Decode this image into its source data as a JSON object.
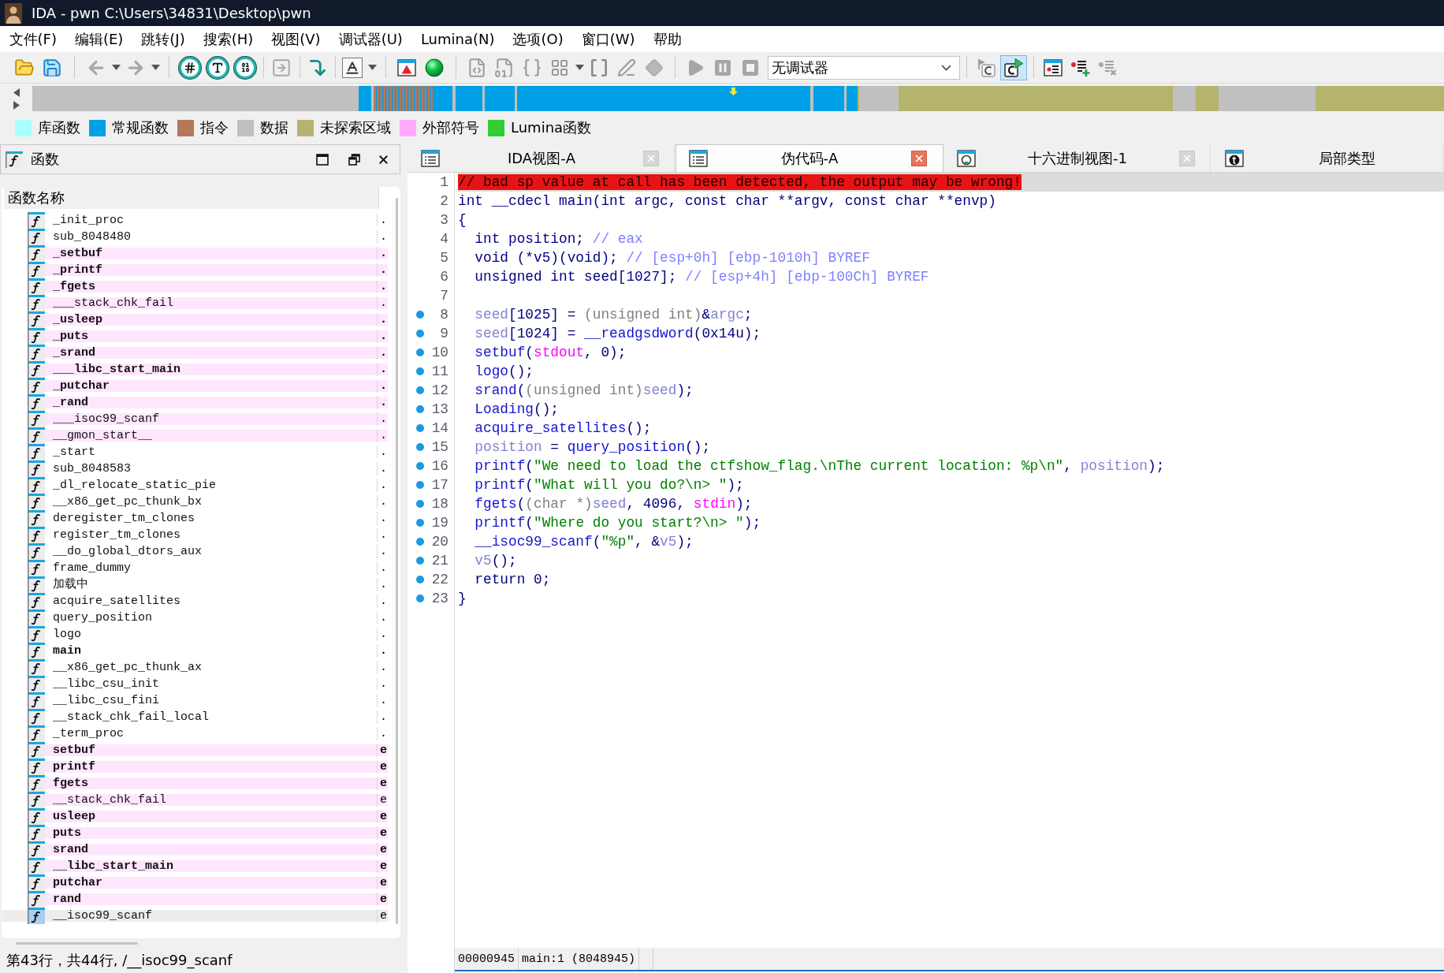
{
  "window": {
    "title": "IDA - pwn C:\\Users\\34831\\Desktop\\pwn"
  },
  "menu": [
    "文件(F)",
    "编辑(E)",
    "跳转(J)",
    "搜索(H)",
    "视图(V)",
    "调试器(U)",
    "Lumina(N)",
    "选项(O)",
    "窗口(W)",
    "帮助"
  ],
  "toolbar": {
    "debugger": "无调试器",
    "sync_pressed": true
  },
  "legend": [
    {
      "label": "库函数",
      "color": "#aaffff"
    },
    {
      "label": "常规函数",
      "color": "#00a0e6"
    },
    {
      "label": "指令",
      "color": "#b5785a"
    },
    {
      "label": "数据",
      "color": "#c0c0c0"
    },
    {
      "label": "未探索区域",
      "color": "#b4b46e"
    },
    {
      "label": "外部符号",
      "color": "#ffaaff"
    },
    {
      "label": "Lumina函数",
      "color": "#33cc33"
    }
  ],
  "functions_panel": {
    "title": "函数",
    "columns": [
      "函数名称"
    ],
    "rows": [
      {
        "name": "_init_proc",
        "segment": ".",
        "kind": "regular",
        "bold": false,
        "selected": false
      },
      {
        "name": "sub_8048480",
        "segment": ".",
        "kind": "regular",
        "bold": false,
        "selected": false
      },
      {
        "name": "_setbuf",
        "segment": ".",
        "kind": "external",
        "bold": true,
        "selected": false
      },
      {
        "name": "_printf",
        "segment": ".",
        "kind": "external",
        "bold": true,
        "selected": false
      },
      {
        "name": "_fgets",
        "segment": ".",
        "kind": "external",
        "bold": true,
        "selected": false
      },
      {
        "name": "___stack_chk_fail",
        "segment": ".",
        "kind": "external",
        "bold": false,
        "selected": false
      },
      {
        "name": "_usleep",
        "segment": ".",
        "kind": "external",
        "bold": true,
        "selected": false
      },
      {
        "name": "_puts",
        "segment": ".",
        "kind": "external",
        "bold": true,
        "selected": false
      },
      {
        "name": "_srand",
        "segment": ".",
        "kind": "external",
        "bold": true,
        "selected": false
      },
      {
        "name": "___libc_start_main",
        "segment": ".",
        "kind": "external",
        "bold": true,
        "selected": false
      },
      {
        "name": "_putchar",
        "segment": ".",
        "kind": "external",
        "bold": true,
        "selected": false
      },
      {
        "name": "_rand",
        "segment": ".",
        "kind": "external",
        "bold": true,
        "selected": false
      },
      {
        "name": "___isoc99_scanf",
        "segment": ".",
        "kind": "external",
        "bold": false,
        "selected": false
      },
      {
        "name": "__gmon_start__",
        "segment": ".",
        "kind": "external",
        "bold": false,
        "selected": false
      },
      {
        "name": "_start",
        "segment": ".",
        "kind": "regular",
        "bold": false,
        "selected": false
      },
      {
        "name": "sub_8048583",
        "segment": ".",
        "kind": "regular",
        "bold": false,
        "selected": false
      },
      {
        "name": "_dl_relocate_static_pie",
        "segment": ".",
        "kind": "regular",
        "bold": false,
        "selected": false
      },
      {
        "name": "__x86_get_pc_thunk_bx",
        "segment": ".",
        "kind": "regular",
        "bold": false,
        "selected": false
      },
      {
        "name": "deregister_tm_clones",
        "segment": ".",
        "kind": "regular",
        "bold": false,
        "selected": false
      },
      {
        "name": "register_tm_clones",
        "segment": ".",
        "kind": "regular",
        "bold": false,
        "selected": false
      },
      {
        "name": "__do_global_dtors_aux",
        "segment": ".",
        "kind": "regular",
        "bold": false,
        "selected": false
      },
      {
        "name": "frame_dummy",
        "segment": ".",
        "kind": "regular",
        "bold": false,
        "selected": false
      },
      {
        "name": "加载中",
        "segment": ".",
        "kind": "regular",
        "bold": false,
        "selected": false
      },
      {
        "name": "acquire_satellites",
        "segment": ".",
        "kind": "regular",
        "bold": false,
        "selected": false
      },
      {
        "name": "query_position",
        "segment": ".",
        "kind": "regular",
        "bold": false,
        "selected": false
      },
      {
        "name": "logo",
        "segment": ".",
        "kind": "regular",
        "bold": false,
        "selected": false
      },
      {
        "name": "main",
        "segment": ".",
        "kind": "regular",
        "bold": true,
        "selected": false
      },
      {
        "name": "__x86_get_pc_thunk_ax",
        "segment": ".",
        "kind": "regular",
        "bold": false,
        "selected": false
      },
      {
        "name": "__libc_csu_init",
        "segment": ".",
        "kind": "regular",
        "bold": false,
        "selected": false
      },
      {
        "name": "__libc_csu_fini",
        "segment": ".",
        "kind": "regular",
        "bold": false,
        "selected": false
      },
      {
        "name": "__stack_chk_fail_local",
        "segment": ".",
        "kind": "regular",
        "bold": false,
        "selected": false
      },
      {
        "name": "_term_proc",
        "segment": ".",
        "kind": "regular",
        "bold": false,
        "selected": false
      },
      {
        "name": "setbuf",
        "segment": "e",
        "kind": "external",
        "bold": true,
        "selected": false
      },
      {
        "name": "printf",
        "segment": "e",
        "kind": "external",
        "bold": true,
        "selected": false
      },
      {
        "name": "fgets",
        "segment": "e",
        "kind": "external",
        "bold": true,
        "selected": false
      },
      {
        "name": "__stack_chk_fail",
        "segment": "e",
        "kind": "external",
        "bold": false,
        "selected": false
      },
      {
        "name": "usleep",
        "segment": "e",
        "kind": "external",
        "bold": true,
        "selected": false
      },
      {
        "name": "puts",
        "segment": "e",
        "kind": "external",
        "bold": true,
        "selected": false
      },
      {
        "name": "srand",
        "segment": "e",
        "kind": "external",
        "bold": true,
        "selected": false
      },
      {
        "name": "__libc_start_main",
        "segment": "e",
        "kind": "external",
        "bold": true,
        "selected": false
      },
      {
        "name": "putchar",
        "segment": "e",
        "kind": "external",
        "bold": true,
        "selected": false
      },
      {
        "name": "rand",
        "segment": "e",
        "kind": "external",
        "bold": true,
        "selected": false
      },
      {
        "name": "__isoc99_scanf",
        "segment": "e",
        "kind": "external",
        "bold": false,
        "selected": true
      }
    ],
    "status": "第43行，共44行, /__isoc99_scanf"
  },
  "tabs": [
    {
      "label": "IDA视图-A",
      "kind": "disassembly",
      "selected": false,
      "closable": true
    },
    {
      "label": "伪代码-A",
      "kind": "pseudocode",
      "selected": true,
      "closable": true
    },
    {
      "label": "十六进制视图-1",
      "kind": "hex",
      "selected": false,
      "closable": true
    },
    {
      "label": "局部类型",
      "kind": "types",
      "selected": false,
      "closable": false
    }
  ],
  "pseudocode": {
    "lines": [
      {
        "number": "1",
        "marked": false,
        "current": true,
        "indented": false,
        "tokens": [
          {
            "text": "// bad sp value at call has been detected, the output may be wrong!",
            "kind": "warning"
          }
        ]
      },
      {
        "number": "2",
        "marked": false,
        "current": false,
        "indented": false,
        "tokens": [
          {
            "text": "int __cdecl main(int argc, const char **argv, const char **envp)",
            "kind": "plain"
          }
        ]
      },
      {
        "number": "3",
        "marked": false,
        "current": false,
        "indented": false,
        "tokens": [
          {
            "text": "{",
            "kind": "plain"
          }
        ]
      },
      {
        "number": "4",
        "marked": false,
        "current": false,
        "indented": true,
        "tokens": [
          {
            "text": "int position; ",
            "kind": "plain"
          },
          {
            "text": "// eax",
            "kind": "comment"
          }
        ]
      },
      {
        "number": "5",
        "marked": false,
        "current": false,
        "indented": true,
        "tokens": [
          {
            "text": "void (*v5)(void); ",
            "kind": "plain"
          },
          {
            "text": "// [esp+0h] [ebp-1010h] BYREF",
            "kind": "comment"
          }
        ]
      },
      {
        "number": "6",
        "marked": false,
        "current": false,
        "indented": true,
        "tokens": [
          {
            "text": "unsigned int seed[1027]; ",
            "kind": "plain"
          },
          {
            "text": "// [esp+4h] [ebp-100Ch] BYREF",
            "kind": "comment"
          }
        ]
      },
      {
        "number": "7",
        "marked": false,
        "current": false
      },
      {
        "number": "8",
        "marked": true,
        "current": false,
        "indented": true,
        "tokens": [
          {
            "text": "seed",
            "kind": "var"
          },
          {
            "text": "[1025] = ",
            "kind": "plain"
          },
          {
            "text": "(unsigned int)",
            "kind": "cast"
          },
          {
            "text": "&",
            "kind": "plain"
          },
          {
            "text": "argc",
            "kind": "var"
          },
          {
            "text": ";",
            "kind": "plain"
          }
        ]
      },
      {
        "number": "9",
        "marked": true,
        "current": false,
        "indented": true,
        "tokens": [
          {
            "text": "seed",
            "kind": "var"
          },
          {
            "text": "[1024] = ",
            "kind": "plain"
          },
          {
            "text": "__readgsdword",
            "kind": "func"
          },
          {
            "text": "(0x14u);",
            "kind": "plain"
          }
        ]
      },
      {
        "number": "10",
        "marked": true,
        "current": false,
        "indented": true,
        "tokens": [
          {
            "text": "setbuf",
            "kind": "func"
          },
          {
            "text": "(",
            "kind": "plain"
          },
          {
            "text": "stdout",
            "kind": "global"
          },
          {
            "text": ", 0);",
            "kind": "plain"
          }
        ]
      },
      {
        "number": "11",
        "marked": true,
        "current": false,
        "indented": true,
        "tokens": [
          {
            "text": "logo",
            "kind": "func"
          },
          {
            "text": "();",
            "kind": "plain"
          }
        ]
      },
      {
        "number": "12",
        "marked": true,
        "current": false,
        "indented": true,
        "tokens": [
          {
            "text": "srand",
            "kind": "func"
          },
          {
            "text": "(",
            "kind": "plain"
          },
          {
            "text": "(unsigned int)",
            "kind": "cast"
          },
          {
            "text": "seed",
            "kind": "var"
          },
          {
            "text": ");",
            "kind": "plain"
          }
        ]
      },
      {
        "number": "13",
        "marked": true,
        "current": false,
        "indented": true,
        "tokens": [
          {
            "text": "Loading",
            "kind": "func"
          },
          {
            "text": "();",
            "kind": "plain"
          }
        ]
      },
      {
        "number": "14",
        "marked": true,
        "current": false,
        "indented": true,
        "tokens": [
          {
            "text": "acquire_satellites",
            "kind": "func"
          },
          {
            "text": "();",
            "kind": "plain"
          }
        ]
      },
      {
        "number": "15",
        "marked": true,
        "current": false,
        "indented": true,
        "tokens": [
          {
            "text": "position",
            "kind": "var"
          },
          {
            "text": " = ",
            "kind": "plain"
          },
          {
            "text": "query_position",
            "kind": "func"
          },
          {
            "text": "();",
            "kind": "plain"
          }
        ]
      },
      {
        "number": "16",
        "marked": true,
        "current": false,
        "indented": true,
        "tokens": [
          {
            "text": "printf",
            "kind": "func"
          },
          {
            "text": "(",
            "kind": "plain"
          },
          {
            "text": "\"We need to load the ctfshow_flag.\\nThe current location: %p\\n\"",
            "kind": "string"
          },
          {
            "text": ", ",
            "kind": "plain"
          },
          {
            "text": "position",
            "kind": "var"
          },
          {
            "text": ");",
            "kind": "plain"
          }
        ]
      },
      {
        "number": "17",
        "marked": true,
        "current": false,
        "indented": true,
        "tokens": [
          {
            "text": "printf",
            "kind": "func"
          },
          {
            "text": "(",
            "kind": "plain"
          },
          {
            "text": "\"What will you do?\\n> \"",
            "kind": "string"
          },
          {
            "text": ");",
            "kind": "plain"
          }
        ]
      },
      {
        "number": "18",
        "marked": true,
        "current": false,
        "indented": true,
        "tokens": [
          {
            "text": "fgets",
            "kind": "func"
          },
          {
            "text": "(",
            "kind": "plain"
          },
          {
            "text": "(char *)",
            "kind": "cast"
          },
          {
            "text": "seed",
            "kind": "var"
          },
          {
            "text": ", 4096, ",
            "kind": "plain"
          },
          {
            "text": "stdin",
            "kind": "global"
          },
          {
            "text": ");",
            "kind": "plain"
          }
        ]
      },
      {
        "number": "19",
        "marked": true,
        "current": false,
        "indented": true,
        "tokens": [
          {
            "text": "printf",
            "kind": "func"
          },
          {
            "text": "(",
            "kind": "plain"
          },
          {
            "text": "\"Where do you start?\\n> \"",
            "kind": "string"
          },
          {
            "text": ");",
            "kind": "plain"
          }
        ]
      },
      {
        "number": "20",
        "marked": true,
        "current": false,
        "indented": true,
        "tokens": [
          {
            "text": "__isoc99_scanf",
            "kind": "func"
          },
          {
            "text": "(",
            "kind": "plain"
          },
          {
            "text": "\"%p\"",
            "kind": "string"
          },
          {
            "text": ", &",
            "kind": "plain"
          },
          {
            "text": "v5",
            "kind": "var"
          },
          {
            "text": ");",
            "kind": "plain"
          }
        ]
      },
      {
        "number": "21",
        "marked": true,
        "current": false,
        "indented": true,
        "tokens": [
          {
            "text": "v5",
            "kind": "var"
          },
          {
            "text": "();",
            "kind": "plain"
          }
        ]
      },
      {
        "number": "22",
        "marked": true,
        "current": false,
        "indented": true,
        "tokens": [
          {
            "text": "return 0;",
            "kind": "plain"
          }
        ]
      },
      {
        "number": "23",
        "marked": true,
        "current": false,
        "indented": false,
        "tokens": [
          {
            "text": "}",
            "kind": "plain"
          }
        ]
      }
    ],
    "status": [
      "00000945",
      "main:1 (8048945)"
    ]
  }
}
